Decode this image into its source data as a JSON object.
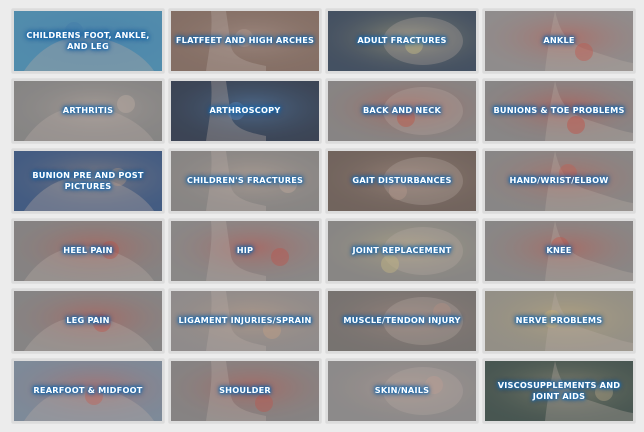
{
  "tiles": [
    {
      "label": "CHILDRENS FOOT, ANKLE, AND LEG",
      "icon": "childrens-foot-icon",
      "bg": "#3f95c4",
      "accent": "#2a7cc0"
    },
    {
      "label": "FLATFEET AND HIGH ARCHES",
      "icon": "flatfeet-icon",
      "bg": "#8a6a5c",
      "accent": "#c7a89a"
    },
    {
      "label": "ADULT FRACTURES",
      "icon": "adult-fractures-icon",
      "bg": "#2c3e57",
      "accent": "#e9d98a"
    },
    {
      "label": "ANKLE",
      "icon": "ankle-icon",
      "bg": "#9a9696",
      "accent": "#e04b3b"
    },
    {
      "label": "ARTHRITIS",
      "icon": "arthritis-icon",
      "bg": "#8d8b8a",
      "accent": "#d9c3b6"
    },
    {
      "label": "ARTHROSCOPY",
      "icon": "arthroscopy-icon",
      "bg": "#1f2c44",
      "accent": "#4b8fd6"
    },
    {
      "label": "BACK AND NECK",
      "icon": "back-neck-icon",
      "bg": "#8e8a89",
      "accent": "#d9442f"
    },
    {
      "label": "BUNIONS & TOE PROBLEMS",
      "icon": "bunions-icon",
      "bg": "#8f8c8c",
      "accent": "#e23b2c"
    },
    {
      "label": "BUNION PRE AND POST PICTURES",
      "icon": "bunion-pictures-icon",
      "bg": "#2a4e86",
      "accent": "#c9a58a"
    },
    {
      "label": "CHILDREN'S FRACTURES",
      "icon": "childrens-fractures-icon",
      "bg": "#8f8b89",
      "accent": "#e1c2ad"
    },
    {
      "label": "GAIT DISTURBANCES",
      "icon": "gait-icon",
      "bg": "#6e5a50",
      "accent": "#cfa694"
    },
    {
      "label": "HAND/WRIST/ELBOW",
      "icon": "hand-wrist-icon",
      "bg": "#908d8c",
      "accent": "#de5645"
    },
    {
      "label": "HEEL PAIN",
      "icon": "heel-pain-icon",
      "bg": "#8b8888",
      "accent": "#d94a37"
    },
    {
      "label": "HIP",
      "icon": "hip-icon",
      "bg": "#928f8e",
      "accent": "#d9443a"
    },
    {
      "label": "JOINT REPLACEMENT",
      "icon": "joint-replacement-icon",
      "bg": "#8f8c8a",
      "accent": "#e6d388"
    },
    {
      "label": "KNEE",
      "icon": "knee-icon",
      "bg": "#908e8d",
      "accent": "#dd4a3a"
    },
    {
      "label": "LEG PAIN",
      "icon": "leg-pain-icon",
      "bg": "#8c8a8a",
      "accent": "#d9483a"
    },
    {
      "label": "LIGAMENT INJURIES/SPRAIN",
      "icon": "ligament-icon",
      "bg": "#9a9494",
      "accent": "#e3b28c"
    },
    {
      "label": "MUSCLE/TENDON INJURY",
      "icon": "muscle-tendon-icon",
      "bg": "#77706c",
      "accent": "#c99a88"
    },
    {
      "label": "NERVE PROBLEMS",
      "icon": "nerve-icon",
      "bg": "#a09a8c",
      "accent": "#e8c77a"
    },
    {
      "label": "REARFOOT & MIDFOOT",
      "icon": "rearfoot-icon",
      "bg": "#7f92a8",
      "accent": "#e05a49"
    },
    {
      "label": "SHOULDER",
      "icon": "shoulder-icon",
      "bg": "#8c8888",
      "accent": "#d84a3b"
    },
    {
      "label": "SKIN/NAILS",
      "icon": "skin-nails-icon",
      "bg": "#959292",
      "accent": "#d9b0a0"
    },
    {
      "label": "VISCOSUPPLEMENTS AND JOINT AIDS",
      "icon": "viscosupplements-icon",
      "bg": "#31463f",
      "accent": "#c8b48a"
    }
  ]
}
